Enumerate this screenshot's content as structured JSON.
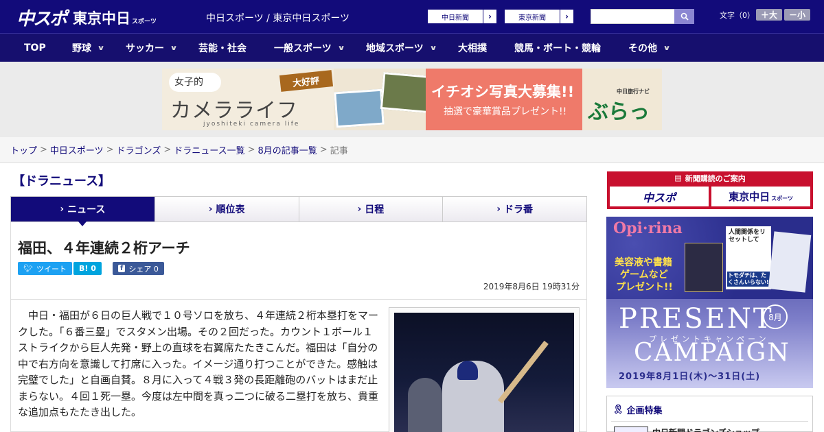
{
  "header": {
    "logo_chuspo": "中スポ",
    "logo_tokyo": "東京中日",
    "logo_sports": "スポーツ",
    "site_name": "中日スポーツ / 東京中日スポーツ",
    "link_chunichi": "中日新聞",
    "link_tokyo": "東京新聞",
    "font_size_label": "文字（0）",
    "font_plus": "＋大",
    "font_minus": "－小",
    "search_placeholder": ""
  },
  "nav": [
    {
      "label": "TOP",
      "has_menu": false
    },
    {
      "label": "野球",
      "has_menu": true
    },
    {
      "label": "サッカー",
      "has_menu": true
    },
    {
      "label": "芸能・社会",
      "has_menu": false
    },
    {
      "label": "一般スポーツ",
      "has_menu": true
    },
    {
      "label": "地域スポーツ",
      "has_menu": true
    },
    {
      "label": "大相撲",
      "has_menu": false
    },
    {
      "label": "競馬・ボート・競輪",
      "has_menu": false
    },
    {
      "label": "その他",
      "has_menu": true
    }
  ],
  "banner": {
    "joshiteki": "女子的",
    "camera_life": "カメラライフ",
    "roman": "jyoshiteki camera life",
    "daikohyo": "大好評",
    "boshu": "イチオシ写真大募集!!",
    "present": "抽選で豪華賞品プレゼント!!",
    "navi": "中日旅行ナビ",
    "burattabi": "ぶらっ人"
  },
  "breadcrumb": [
    "トップ",
    "中日スポーツ",
    "ドラゴンズ",
    "ドラニュース一覧",
    "8月の記事一覧",
    "記事"
  ],
  "section_title": "【ドラニュース】",
  "tabs": [
    "ニュース",
    "順位表",
    "日程",
    "ドラ番"
  ],
  "article": {
    "headline": "福田、４年連続２桁アーチ",
    "tweet": "ツイート",
    "hatena": "B! 0",
    "fb_share": "シェア 0",
    "date": "2019年8月6日 19時31分",
    "body": "中日・福田が６日の巨人戦で１０号ソロを放ち、４年連続２桁本塁打をマークした。「６番三塁」でスタメン出場。その２回だった。カウント１ボール１ストライクから巨人先発・野上の直球を右翼席たたきこんだ。福田は「自分の中で右方向を意識して打席に入った。イメージ通り打つことができた。感触は完璧でした」と自画自賛。８月に入って４戦３発の長距離砲のバットはまだ止まらない。４回１死一塁。今度は左中間を真っ二つに破る二塁打を放ち、貴重な追加点もたたき出した。"
  },
  "sidebar": {
    "subscription_title": "新聞購読のご案内",
    "sub_chuspo": "中スポ",
    "sub_tokyo": "東京中日",
    "sub_sports": "スポーツ",
    "ad_brand": "Opi·rina",
    "ad_line1": "美容液や書籍",
    "ad_line2": "ゲームなど",
    "ad_line3": "プレゼント!!",
    "ad_present": "PRESENT",
    "ad_kana": "プレゼントキャンペーン",
    "ad_campaign": "CAMPAIGN",
    "ad_month": "8月",
    "ad_period": "2019年8月1日(木)〜31日(土)",
    "ad_book1": "人間関係をリセットして",
    "ad_book2": "トモダチは、たくさんいらない!",
    "kikaku_title": "企画特集",
    "kikaku_item": "中日新聞ドラゴンズショップ"
  },
  "colors": {
    "navy": "#120b7a",
    "accent_red": "#c8102e",
    "twitter": "#1da1f2",
    "hatena": "#00a4de",
    "facebook": "#3b5998"
  }
}
